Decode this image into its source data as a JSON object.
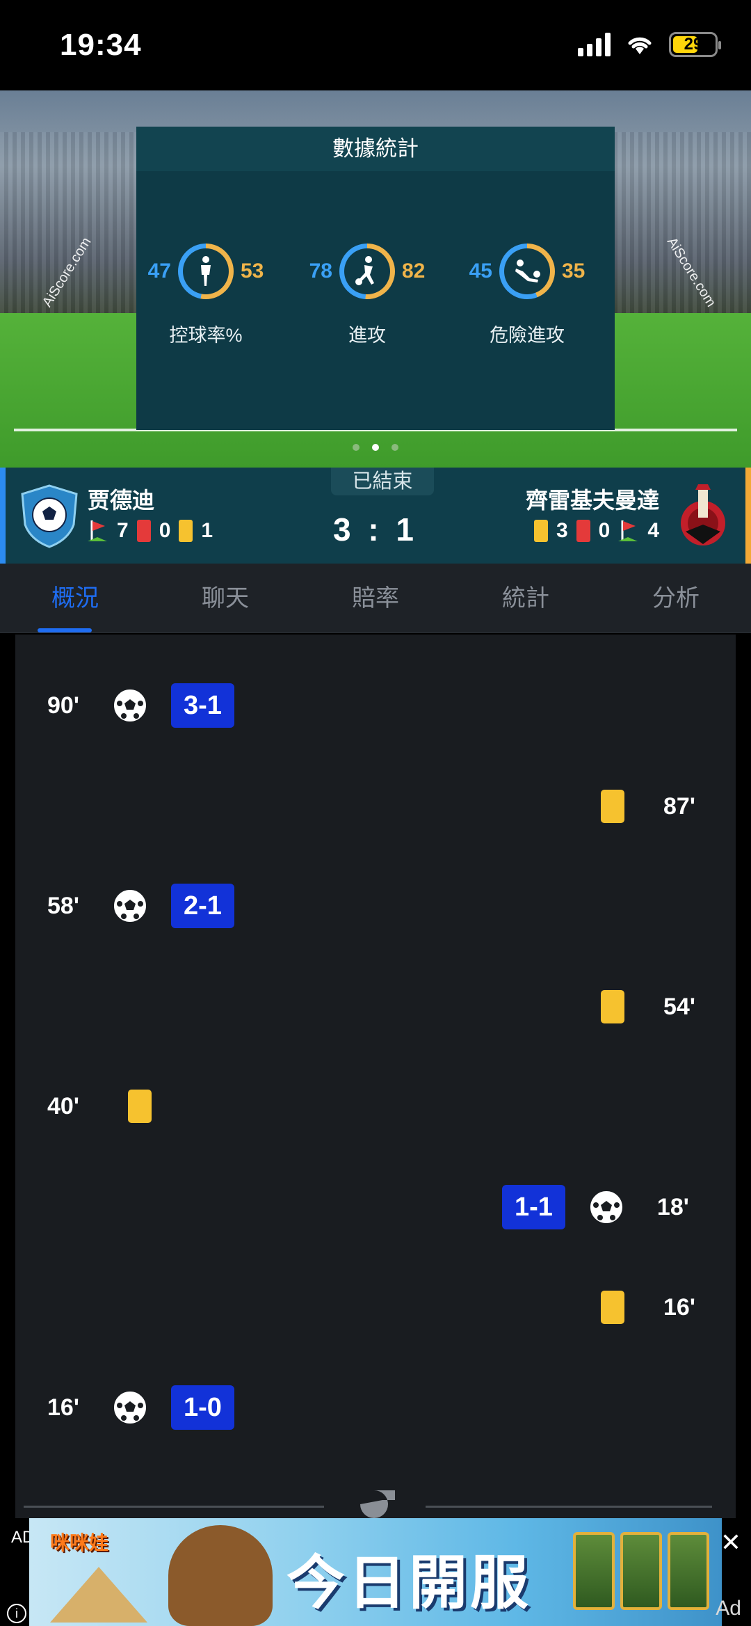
{
  "status": {
    "time": "19:34",
    "battery": "29"
  },
  "stats_panel": {
    "title": "數據統計",
    "items": [
      {
        "label": "控球率%",
        "home": "47",
        "away": "53",
        "icon": "player-standing-icon"
      },
      {
        "label": "進攻",
        "home": "78",
        "away": "82",
        "icon": "player-kicking-icon"
      },
      {
        "label": "危險進攻",
        "home": "45",
        "away": "35",
        "icon": "player-sliding-icon"
      }
    ],
    "brand": "AiScore.com",
    "page_index": 2,
    "page_count": 3
  },
  "match": {
    "status": "已結束",
    "score": "3 : 1",
    "home": {
      "name": "贾德迪",
      "corners": "7",
      "red": "0",
      "yellow": "1"
    },
    "away": {
      "name": "齊雷基夫曼達",
      "yellow": "3",
      "red": "0",
      "corners": "4"
    }
  },
  "tabs": [
    "概況",
    "聊天",
    "賠率",
    "統計",
    "分析"
  ],
  "active_tab": "概況",
  "events": [
    {
      "minute": "90'",
      "side": "home",
      "type": "goal",
      "score": "3-1"
    },
    {
      "minute": "87'",
      "side": "away",
      "type": "yellow"
    },
    {
      "minute": "58'",
      "side": "home",
      "type": "goal",
      "score": "2-1"
    },
    {
      "minute": "54'",
      "side": "away",
      "type": "yellow"
    },
    {
      "minute": "40'",
      "side": "home",
      "type": "yellow"
    },
    {
      "minute": "18'",
      "side": "away",
      "type": "goal",
      "score": "1-1"
    },
    {
      "minute": "16'",
      "side": "away",
      "type": "yellow"
    },
    {
      "minute": "16'",
      "side": "home",
      "type": "goal",
      "score": "1-0"
    }
  ],
  "ad": {
    "label": "AD",
    "brand": "咪咪娃",
    "text": "今日開服",
    "tag": "Ad",
    "close": "✕",
    "info": "i"
  },
  "colors": {
    "home": "#2c8cf2",
    "away": "#f2a936",
    "accent": "#1f6df2",
    "goal_badge": "#1232d8",
    "yellow_card": "#f6c22f",
    "red_card": "#e43a3a"
  }
}
